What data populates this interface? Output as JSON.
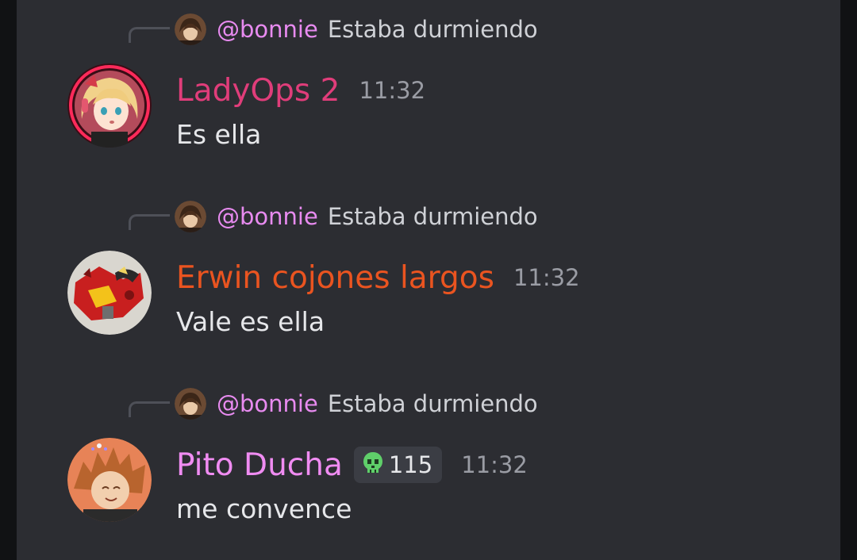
{
  "colors": {
    "background": "#2c2d32",
    "mention": "#e88bf0",
    "timestamp": "#9a9ca4",
    "text": "#e6e7ea"
  },
  "messages": [
    {
      "reply": {
        "mention": "@bonnie",
        "text": "Estaba durmiendo",
        "avatar_icon": "bonnie-avatar"
      },
      "author": "LadyOps 2",
      "author_color": "#e03d7a",
      "time": "11:32",
      "content": "Es ella",
      "avatar_icon": "anime-girl-avatar"
    },
    {
      "reply": {
        "mention": "@bonnie",
        "text": "Estaba durmiendo",
        "avatar_icon": "bonnie-avatar"
      },
      "author": "Erwin cojones largos",
      "author_color": "#ea5420",
      "time": "11:32",
      "content": "Vale es ella",
      "avatar_icon": "red-robot-avatar"
    },
    {
      "reply": {
        "mention": "@bonnie",
        "text": "Estaba durmiendo",
        "avatar_icon": "bonnie-avatar"
      },
      "author": "Pito Ducha",
      "author_color": "#f08cf2",
      "time": "11:32",
      "content": "me convence",
      "avatar_icon": "spiky-hair-avatar",
      "tag": {
        "icon": "skull-icon",
        "label": "115"
      }
    }
  ]
}
